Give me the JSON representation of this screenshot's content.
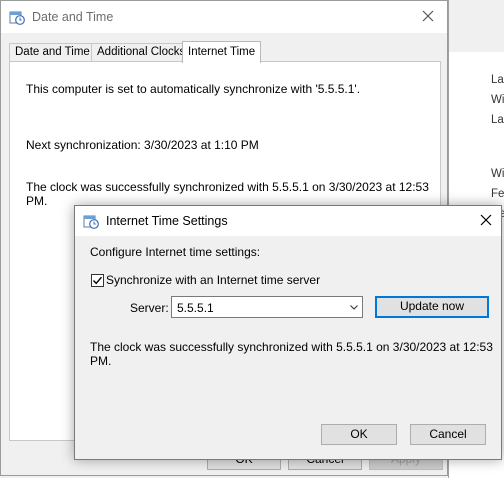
{
  "main_window": {
    "title": "Date and Time",
    "tabs": [
      {
        "label": "Date and Time"
      },
      {
        "label": "Additional Clocks"
      },
      {
        "label": "Internet Time"
      }
    ],
    "active_tab": "Internet Time",
    "panel": {
      "sync_text": "This computer is set to automatically synchronize with '5.5.5.1'.",
      "next_sync": "Next synchronization: 3/30/2023 at 1:10 PM",
      "status_line1": "The clock was successfully synchronized with 5.5.5.1 on 3/30/2023 at 12:53",
      "status_line2": "PM."
    },
    "buttons": {
      "ok": "OK",
      "cancel": "Cancel",
      "apply": "Apply"
    }
  },
  "settings_dialog": {
    "title": "Internet Time Settings",
    "configure_label": "Configure Internet time settings:",
    "sync_checkbox_label": "Synchronize with an Internet time server",
    "sync_checked": true,
    "server_label": "Server:",
    "server_value": "5.5.5.1",
    "update_button": "Update now",
    "status_line1": "The clock was successfully synchronized with 5.5.5.1 on 3/30/2023 at 12:53",
    "status_line2": "PM.",
    "ok_button": "OK",
    "cancel_button": "Cancel"
  },
  "background_window": {
    "texts": [
      "Las",
      "Wi",
      "Las",
      "Wi",
      "Fec",
      "Ce"
    ]
  },
  "icons": {
    "title_icon": "date-time-icon",
    "close_icon": "close-icon",
    "dropdown_icon": "chevron-down-icon",
    "check_icon": "checkmark-icon"
  },
  "colors": {
    "accent": "#0078d7",
    "window_bg": "#f0f0f0",
    "panel_bg": "#ffffff"
  }
}
